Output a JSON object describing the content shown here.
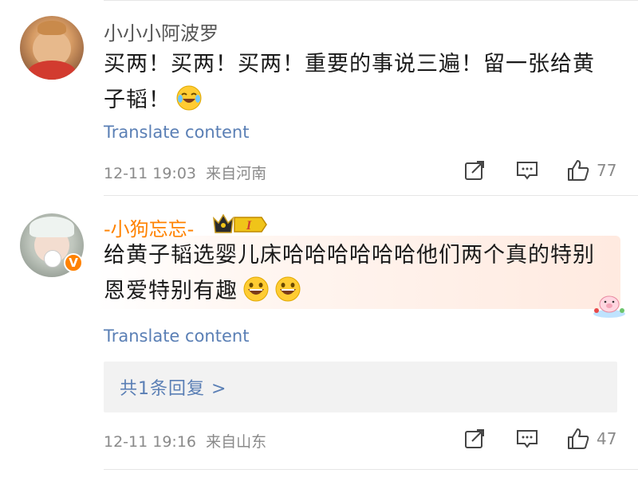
{
  "comments": [
    {
      "username": "小小小阿波罗",
      "text": "买两！买两！买两！重要的事说三遍！留一张给黄子韬！",
      "emoji": "laughing-tears-emoji",
      "translate": "Translate content",
      "timestamp": "12-11 19:03",
      "location": "来自河南",
      "likes": "77"
    },
    {
      "username": "-小狗忘忘-",
      "badge": "crown-level-icon",
      "badge_level": "I",
      "text": "给黄子韬选婴儿床哈哈哈哈哈哈他们两个真的特别恩爱特别有趣",
      "emoji": "grinning-emoji",
      "translate": "Translate content",
      "replies": "共1条回复 >",
      "timestamp": "12-11 19:16",
      "location": "来自山东",
      "likes": "47",
      "verified": "V"
    }
  ],
  "colors": {
    "accent": "#ff8200",
    "link": "#5a7fb5",
    "meta": "#8a8a8a"
  }
}
